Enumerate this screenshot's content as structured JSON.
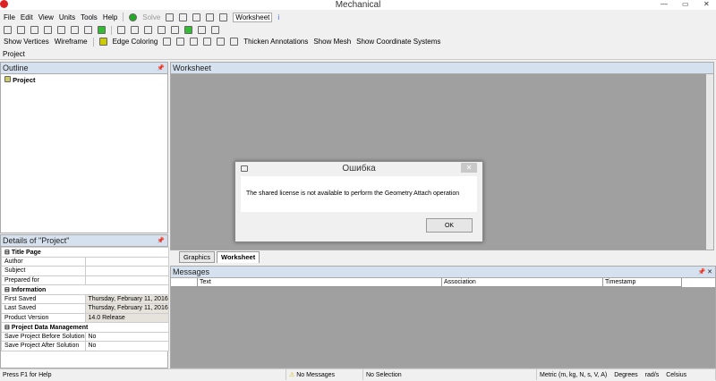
{
  "window": {
    "title": "Mechanical"
  },
  "menu": [
    "File",
    "Edit",
    "View",
    "Units",
    "Tools",
    "Help"
  ],
  "toolbar1": {
    "solve": "Solve",
    "worksheet": "Worksheet"
  },
  "toolbar3": {
    "show_vertices": "Show Vertices",
    "wireframe": "Wireframe",
    "edge_coloring": "Edge Coloring",
    "thicken": "Thicken Annotations",
    "show_mesh": "Show Mesh",
    "show_coords": "Show Coordinate Systems"
  },
  "breadcrumb": "Project",
  "outline": {
    "title": "Outline",
    "root": "Project"
  },
  "details": {
    "title": "Details of \"Project\"",
    "groups": [
      {
        "name": "Title Page",
        "rows": [
          [
            "Author",
            ""
          ],
          [
            "Subject",
            ""
          ],
          [
            "Prepared for",
            ""
          ]
        ]
      },
      {
        "name": "Information",
        "rows": [
          [
            "First Saved",
            "Thursday, February 11, 2016"
          ],
          [
            "Last Saved",
            "Thursday, February 11, 2016"
          ],
          [
            "Product Version",
            "14.0  Release"
          ]
        ]
      },
      {
        "name": "Project Data Management",
        "rows": [
          [
            "Save Project Before Solution",
            "No"
          ],
          [
            "Save Project After Solution",
            "No"
          ]
        ]
      }
    ]
  },
  "worksheet": {
    "title": "Worksheet",
    "tabs": [
      "Graphics",
      "Worksheet"
    ]
  },
  "messages": {
    "title": "Messages",
    "columns": [
      "Text",
      "Association",
      "Timestamp"
    ]
  },
  "status": {
    "help": "Press F1 for Help",
    "messages": "No Messages",
    "selection": "No Selection",
    "units": "Metric (m, kg, N, s, V, A)",
    "angle": "Degrees",
    "rot": "rad/s",
    "temp": "Celsius"
  },
  "dialog": {
    "title": "Ошибка",
    "message": "The shared license is not available to perform the Geometry Attach operation",
    "ok": "OK"
  }
}
